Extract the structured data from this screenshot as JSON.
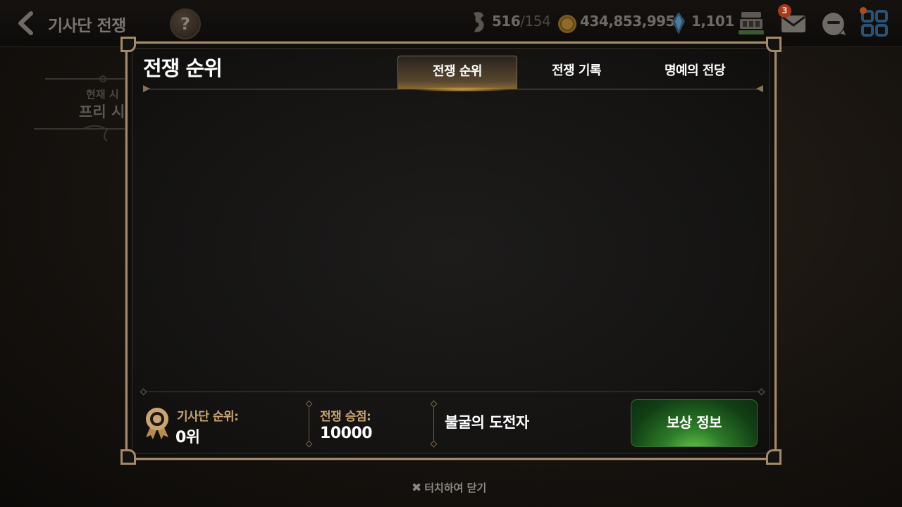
{
  "header": {
    "title": "기사단 전쟁",
    "help_label": "?",
    "resources": {
      "stamina_value": "516",
      "stamina_max": "/154",
      "gold": "434,853,995",
      "crystal": "1,101"
    },
    "mail_badge": "3"
  },
  "background": {
    "line1": "현재 시",
    "line2": "프리 시"
  },
  "modal": {
    "title": "전쟁 순위",
    "tabs": [
      {
        "label": "전쟁 순위",
        "active": true
      },
      {
        "label": "전쟁 기록",
        "active": false
      },
      {
        "label": "명예의 전당",
        "active": false
      }
    ],
    "footer": {
      "rank_label": "기사단 순위:",
      "rank_value": "0위",
      "points_label": "전쟁 승점:",
      "points_value": "10000",
      "title_text": "불굴의 도전자",
      "reward_button": "보상 정보"
    }
  },
  "close_hint": "터치하여 닫기",
  "colors": {
    "frame": "#a48a6a",
    "accent_gold": "#c9a473",
    "button_green": "#2e7d28"
  },
  "icons": [
    "back-arrow-icon",
    "help-icon",
    "stamina-icon",
    "gold-coin-icon",
    "crystal-icon",
    "guild-hall-icon",
    "mail-icon",
    "chat-icon",
    "menu-grid-icon",
    "medal-icon",
    "close-x-icon"
  ]
}
